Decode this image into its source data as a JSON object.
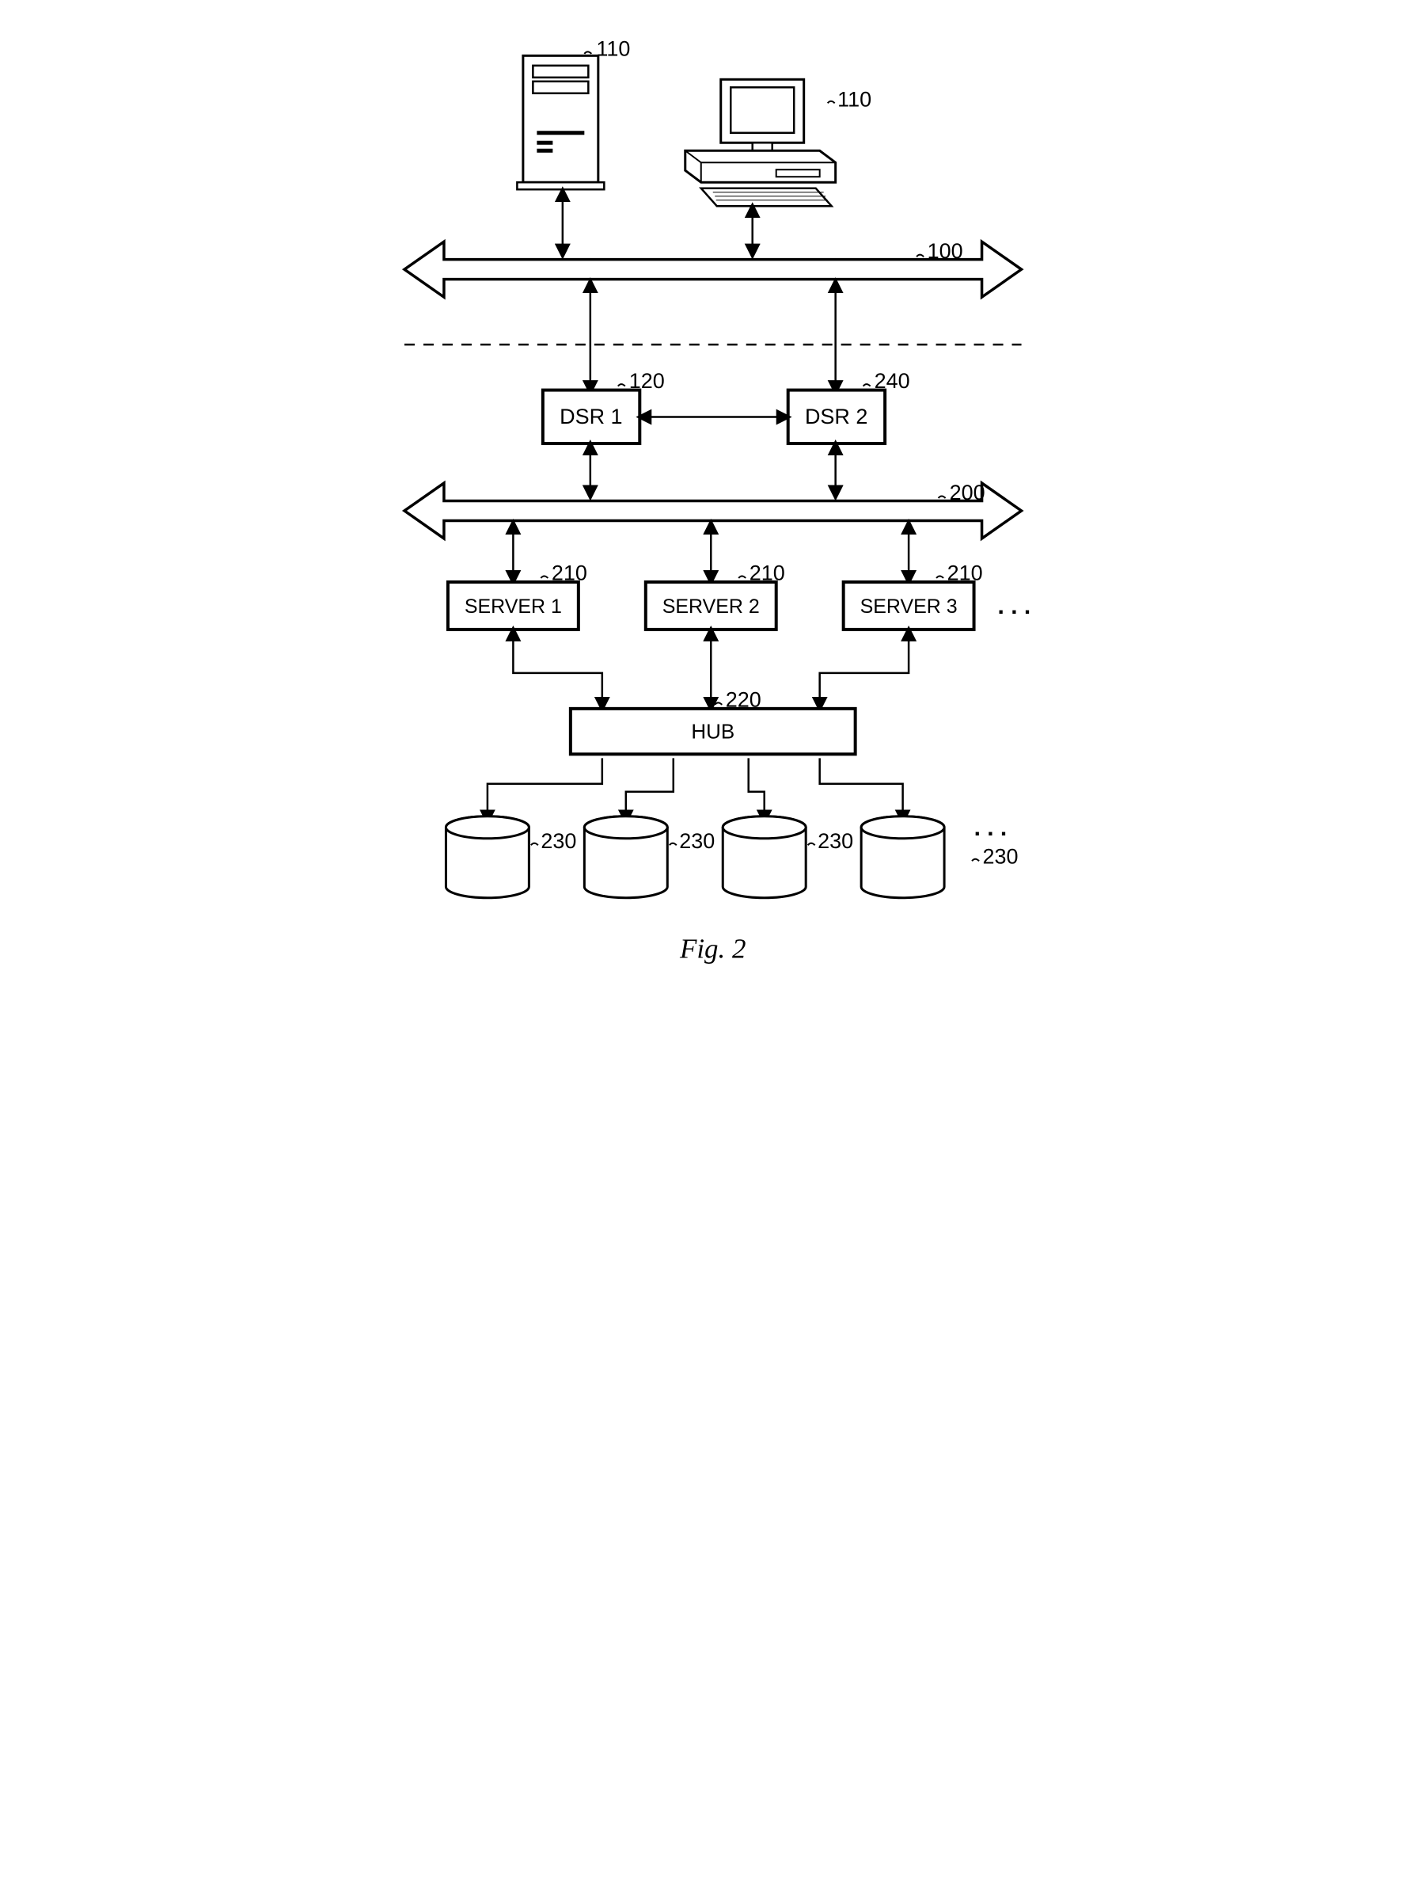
{
  "figure_label": "Fig. 2",
  "labels": {
    "tower_ref": "110",
    "desktop_ref": "110",
    "bus1_ref": "100",
    "dsr1_ref": "120",
    "dsr2_ref": "240",
    "bus2_ref": "200",
    "server1_ref": "210",
    "server2_ref": "210",
    "server3_ref": "210",
    "hub_ref": "220",
    "disk1_ref": "230",
    "disk2_ref": "230",
    "disk3_ref": "230",
    "disk4_ref": "230"
  },
  "boxes": {
    "dsr1": "DSR 1",
    "dsr2": "DSR 2",
    "server1": "SERVER 1",
    "server2": "SERVER 2",
    "server3": "SERVER 3",
    "hub": "HUB"
  },
  "ellipsis": ". . ."
}
